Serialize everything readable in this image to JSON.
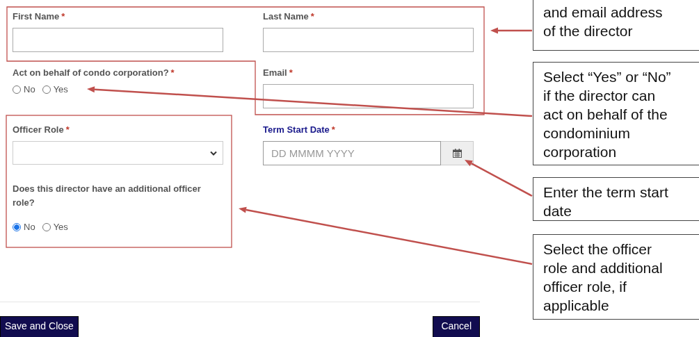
{
  "form": {
    "first_name": {
      "label": "First Name",
      "required_mark": "*"
    },
    "last_name": {
      "label": "Last Name",
      "required_mark": "*"
    },
    "act_on_behalf": {
      "label": "Act on behalf of condo corporation?",
      "required_mark": "*",
      "options": [
        {
          "label": "No",
          "selected": false
        },
        {
          "label": "Yes",
          "selected": false
        }
      ]
    },
    "email": {
      "label": "Email",
      "required_mark": "*"
    },
    "officer_role": {
      "label": "Officer Role",
      "required_mark": "*"
    },
    "term_start_date": {
      "label": "Term Start Date",
      "required_mark": "*",
      "placeholder": "DD MMMM YYYY"
    },
    "additional_role": {
      "label": "Does this director have an additional officer role?",
      "options": [
        {
          "label": "No",
          "selected": true
        },
        {
          "label": "Yes",
          "selected": false
        }
      ]
    }
  },
  "buttons": [
    {
      "label": "Save and Close"
    },
    {
      "label": "Cancel"
    }
  ],
  "callouts": [
    {
      "text": "and email address\nof the director"
    },
    {
      "text": "Select “Yes” or “No”\nif the director can\nact on behalf of the\ncondominium\ncorporation"
    },
    {
      "text": "Enter the term start\ndate"
    },
    {
      "text": "Select the officer\nrole and additional\nofficer role, if\napplicable"
    }
  ]
}
